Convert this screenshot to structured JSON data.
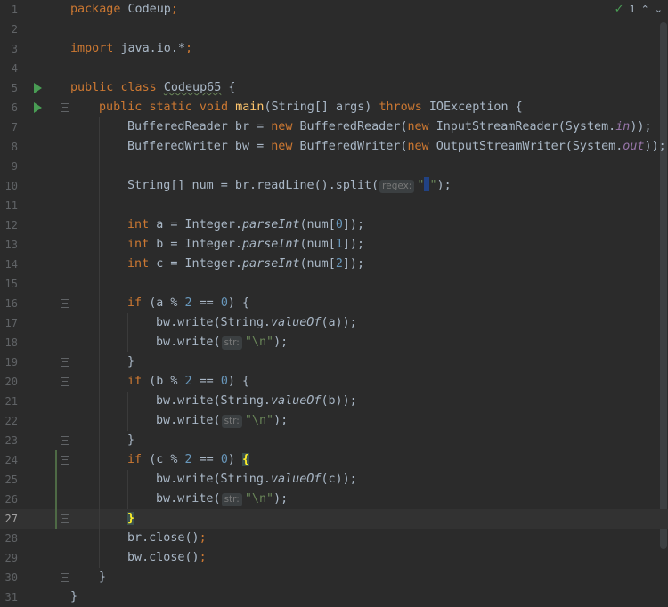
{
  "editor": {
    "current_line": 27,
    "lines": [
      {
        "n": "1"
      },
      {
        "n": "2"
      },
      {
        "n": "3"
      },
      {
        "n": "4"
      },
      {
        "n": "5"
      },
      {
        "n": "6"
      },
      {
        "n": "7"
      },
      {
        "n": "8"
      },
      {
        "n": "9"
      },
      {
        "n": "10"
      },
      {
        "n": "11"
      },
      {
        "n": "12"
      },
      {
        "n": "13"
      },
      {
        "n": "14"
      },
      {
        "n": "15"
      },
      {
        "n": "16"
      },
      {
        "n": "17"
      },
      {
        "n": "18"
      },
      {
        "n": "19"
      },
      {
        "n": "20"
      },
      {
        "n": "21"
      },
      {
        "n": "22"
      },
      {
        "n": "23"
      },
      {
        "n": "24"
      },
      {
        "n": "25"
      },
      {
        "n": "26"
      },
      {
        "n": "27"
      },
      {
        "n": "28"
      },
      {
        "n": "29"
      },
      {
        "n": "30"
      },
      {
        "n": "31"
      }
    ],
    "code": {
      "l1": {
        "kw": "package",
        "name": "Codeup",
        "end": ";"
      },
      "l3": {
        "kw": "import",
        "name": "java.io.*",
        "end": ";"
      },
      "l5": {
        "kw1": "public",
        "kw2": "class",
        "name": "Codeup65",
        "end": "{"
      },
      "l6": {
        "kw1": "public",
        "kw2": "static",
        "kw3": "void",
        "fn": "main",
        "params": "(String[] args)",
        "kw4": "throws",
        "exc": "IOException",
        "end": "{"
      },
      "l7": {
        "a": "BufferedReader br = ",
        "kw": "new",
        "b": "BufferedReader(",
        "kw2": "new",
        "c": "InputStreamReader(System.",
        "field": "in",
        "d": "));"
      },
      "l8": {
        "a": "BufferedWriter bw = ",
        "kw": "new",
        "b": "BufferedWriter(",
        "kw2": "new",
        "c": "OutputStreamWriter(System.",
        "field": "out",
        "d": "));"
      },
      "l10": {
        "a": "String[] num = br.readLine().split(",
        "hint": "regex:",
        "str_open": "\"",
        "str_close": "\"",
        "d": ");"
      },
      "l12": {
        "kw": "int",
        "a": "a = Integer.",
        "m": "parseInt",
        "b": "(num[",
        "num": "0",
        "c": "]);"
      },
      "l13": {
        "kw": "int",
        "a": "b = Integer.",
        "m": "parseInt",
        "b": "(num[",
        "num": "1",
        "c": "]);"
      },
      "l14": {
        "kw": "int",
        "a": "c = Integer.",
        "m": "parseInt",
        "b": "(num[",
        "num": "2",
        "c": "]);"
      },
      "l16": {
        "kw": "if",
        "a": "(a % ",
        "n1": "2",
        "b": " == ",
        "n2": "0",
        "c": ") {"
      },
      "l17": {
        "a": "bw.write(String.",
        "m": "valueOf",
        "b": "(a));"
      },
      "l18": {
        "a": "bw.write(",
        "hint": "str:",
        "str": "\"\\n\"",
        "b": ");"
      },
      "l19": {
        "a": "}"
      },
      "l20": {
        "kw": "if",
        "a": "(b % ",
        "n1": "2",
        "b": " == ",
        "n2": "0",
        "c": ") {"
      },
      "l21": {
        "a": "bw.write(String.",
        "m": "valueOf",
        "b": "(b));"
      },
      "l22": {
        "a": "bw.write(",
        "hint": "str:",
        "str": "\"\\n\"",
        "b": ");"
      },
      "l23": {
        "a": "}"
      },
      "l24": {
        "kw": "if",
        "a": "(c % ",
        "n1": "2",
        "b": " == ",
        "n2": "0",
        "c": ") ",
        "brace": "{"
      },
      "l25": {
        "a": "bw.write(String.",
        "m": "valueOf",
        "b": "(c));"
      },
      "l26": {
        "a": "bw.write(",
        "hint": "str:",
        "str": "\"\\n\"",
        "b": ");"
      },
      "l27": {
        "brace": "}"
      },
      "l28": {
        "a": "br.close()",
        "end": ";"
      },
      "l29": {
        "a": "bw.close()",
        "end": ";"
      },
      "l30": {
        "a": "}"
      },
      "l31": {
        "a": "}"
      }
    }
  },
  "status": {
    "inspection_count": "1",
    "check_icon": "check-icon",
    "up_icon": "chevron-up-icon",
    "down_icon": "chevron-down-icon"
  },
  "colors": {
    "background": "#2b2b2b",
    "keyword": "#cc7832",
    "string": "#6a8759",
    "number": "#6897bb",
    "function": "#ffc66d",
    "field": "#9876aa"
  }
}
